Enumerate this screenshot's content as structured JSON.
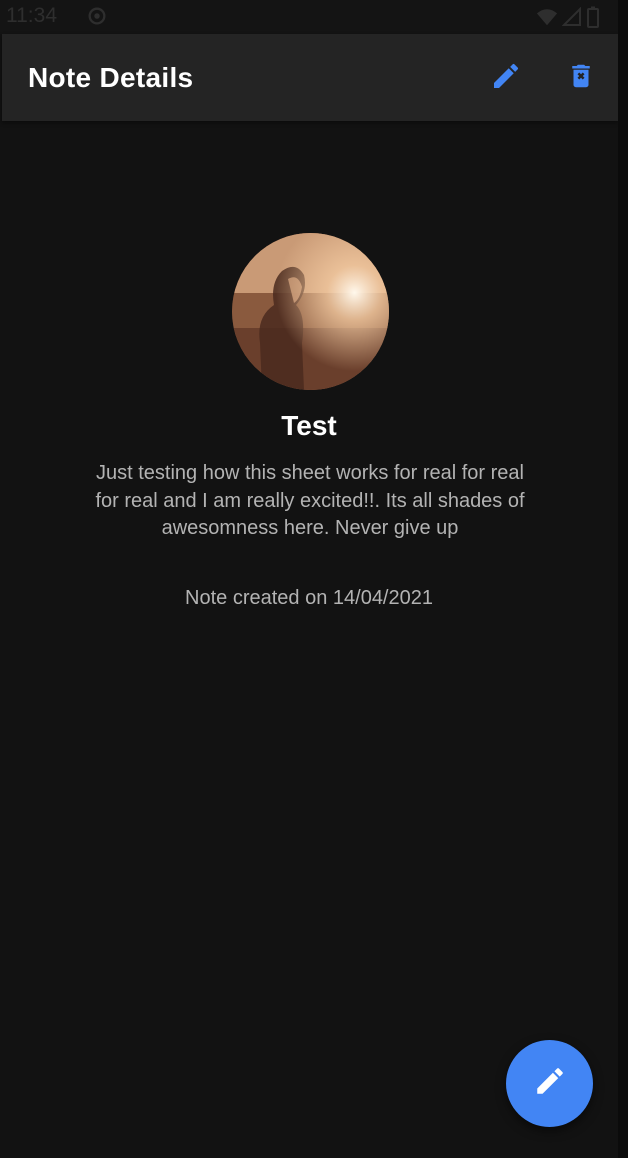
{
  "status_bar": {
    "time": "11:34",
    "icons": [
      "sync-icon",
      "wifi-icon",
      "signal-icon",
      "battery-icon"
    ]
  },
  "app_bar": {
    "title": "Note Details",
    "actions": [
      {
        "name": "edit-icon",
        "color": "#4285f4"
      },
      {
        "name": "delete-icon",
        "color": "#4285f4"
      }
    ]
  },
  "note": {
    "title": "Test",
    "body": "Just testing how this sheet works for real for real for real and I am really excited!!. Its all shades of awesomness here. Never give up",
    "created": "Note created on 14/04/2021",
    "image": "note-image"
  },
  "fab": {
    "icon": "edit-icon",
    "color": "#4285f4"
  },
  "colors": {
    "background": "#121212",
    "app_bar": "#242424",
    "accent": "#4285f4",
    "text_primary": "#ffffff",
    "text_secondary": "#b3b3b3"
  }
}
